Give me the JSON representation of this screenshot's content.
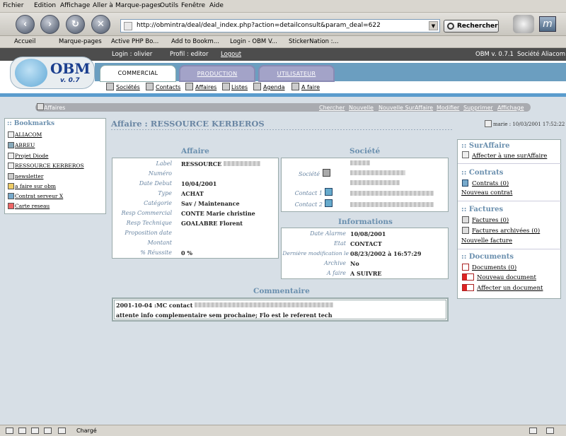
{
  "menubar": {
    "items": [
      "Fichier",
      "Edition",
      "Affichage",
      "Aller à",
      "Marque-pages",
      "Outils",
      "Fenêtre",
      "Aide"
    ]
  },
  "navbar": {
    "url": "http://obmintra/deal/deal_index.php?action=detailconsult&param_deal=622",
    "search_label": "Rechercher"
  },
  "bookmarks_toolbar": {
    "items": [
      "Accueil",
      "Marque-pages",
      "Active PHP Bo...",
      "Add to Bookm...",
      "Login - OBM V...",
      "StickerNation :..."
    ]
  },
  "obm": {
    "login": "Login : olivier",
    "profil": "Profil : editor",
    "logout": "Logout",
    "version": "OBM v. 0.7.1",
    "societe": "Société Aliacom",
    "logo_text": "OBM",
    "logo_version": "v. 0.7",
    "tabs": [
      "COMMERCIAL",
      "PRODUCTION",
      "UTILISATEUR"
    ],
    "subnav": [
      "Sociétés",
      "Contacts",
      "Affaires",
      "Listes",
      "Agenda",
      "A faire"
    ]
  },
  "actionbar": {
    "section": "Affaires",
    "actions": [
      "Chercher",
      "Nouvelle",
      "Nouvelle SurAffaire",
      "Modifier",
      "Supprimer",
      "Affichage"
    ]
  },
  "bookmarks_panel": {
    "title": ":: Bookmarks",
    "items": [
      "ALIACOM",
      "ABREU",
      "Projet Diode",
      "RESSOURCE KERBEROS",
      "newsletter",
      "a faire sur obm",
      "Contrat serveur X",
      "Carte reseau"
    ]
  },
  "page": {
    "title": "Affaire : RESSOURCE KERBEROS",
    "update_info": "marie : 10/03/2001 17:52:22"
  },
  "affaire": {
    "heading": "Affaire",
    "rows": [
      {
        "label": "Label",
        "value": "RESSOURCE"
      },
      {
        "label": "Numéro",
        "value": ""
      },
      {
        "label": "Date Debut",
        "value": "10/04/2001"
      },
      {
        "label": "Type",
        "value": "ACHAT"
      },
      {
        "label": "Catégorie",
        "value": "Sav / Maintenance"
      },
      {
        "label": "Resp Commercial",
        "value": "CONTE Marie christine"
      },
      {
        "label": "Resp Technique",
        "value": "GOALABRE Florent"
      },
      {
        "label": "Proposition date",
        "value": ""
      },
      {
        "label": "Montant",
        "value": ""
      },
      {
        "label": "% Réussite",
        "value": "0 %"
      }
    ]
  },
  "societe": {
    "heading": "Société",
    "rows": [
      {
        "label": "Société"
      },
      {
        "label": "Contact 1"
      },
      {
        "label": "Contact 2"
      }
    ]
  },
  "informations": {
    "heading": "Informations",
    "rows": [
      {
        "label": "Date Alarme",
        "value": "10/08/2001"
      },
      {
        "label": "Etat",
        "value": "CONTACT"
      },
      {
        "label": "Dernière modification le",
        "value": "08/23/2002 à 16:57:29"
      },
      {
        "label": "Archive",
        "value": "No"
      },
      {
        "label": "A faire",
        "value": "A SUIVRE"
      }
    ]
  },
  "commentaire": {
    "heading": "Commentaire",
    "line1": "2001-10-04 :MC contact",
    "line2": "attente info complementaire sem prochaine; Flo est le referent tech"
  },
  "right_panel": {
    "surAffaire": {
      "title": ":: SurAffaire",
      "link": "Affecter à une surAffaire"
    },
    "contrats": {
      "title": ":: Contrats",
      "items": [
        "Contrats (0)",
        "Nouveau contrat"
      ]
    },
    "factures": {
      "title": ":: Factures",
      "items": [
        "Factures (0)",
        "Factures archivées (0)",
        "Nouvelle facture"
      ]
    },
    "documents": {
      "title": ":: Documents",
      "items": [
        "Documents (0)",
        "Nouveau document",
        "Affecter un document"
      ]
    }
  },
  "statusbar": {
    "text": "Chargé"
  }
}
